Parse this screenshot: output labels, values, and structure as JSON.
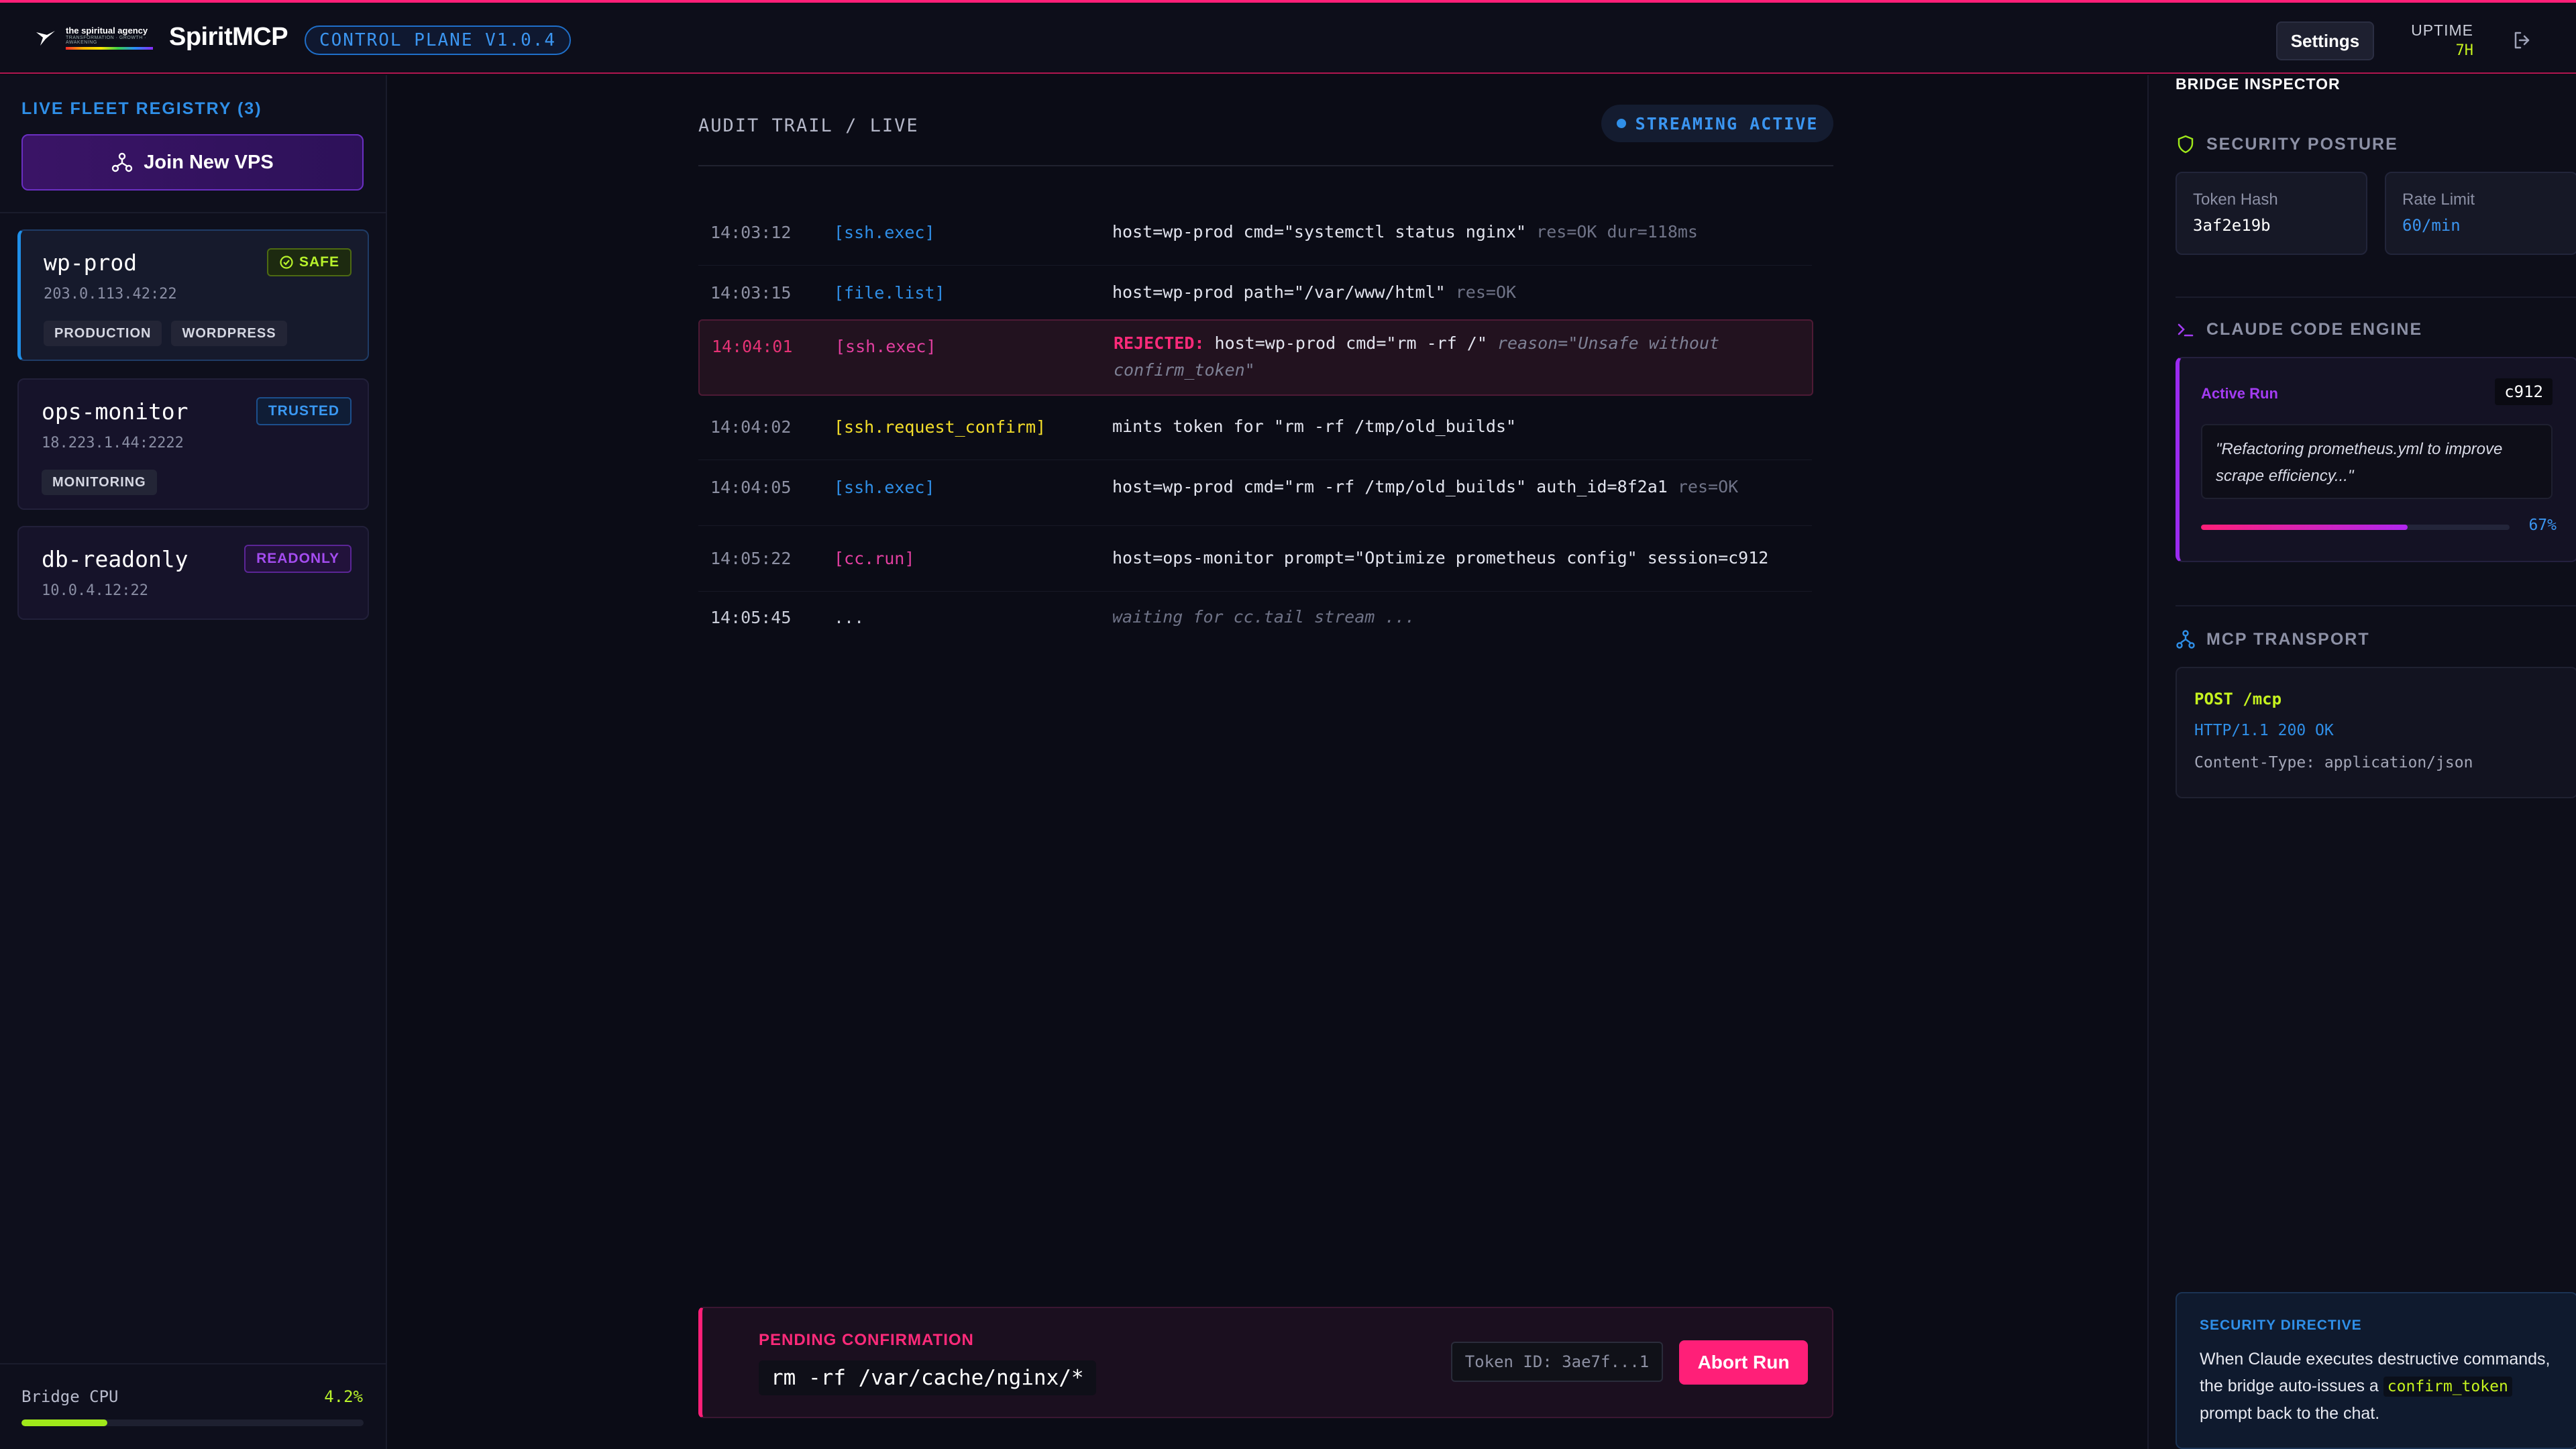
{
  "header": {
    "logo_line1": "the spiritual agency",
    "logo_line2": "TRANSFORMATION · GROWTH · AWAKENING",
    "brand": "SpiritMCP",
    "version": "CONTROL PLANE V1.0.4",
    "settings_label": "Settings",
    "uptime_label": "UPTIME",
    "uptime_value": "7H"
  },
  "sidebar": {
    "fleet_title": "LIVE FLEET REGISTRY (3)",
    "join_label": "Join New VPS",
    "hosts": [
      {
        "name": "wp-prod",
        "ip": "203.0.113.42:22",
        "badge": "SAFE",
        "tags": [
          "PRODUCTION",
          "WORDPRESS"
        ]
      },
      {
        "name": "ops-monitor",
        "ip": "18.223.1.44:2222",
        "badge": "TRUSTED",
        "tags": [
          "MONITORING"
        ]
      },
      {
        "name": "db-readonly",
        "ip": "10.0.4.12:22",
        "badge": "READONLY",
        "tags": []
      }
    ],
    "cpu_label": "Bridge CPU",
    "cpu_value": "4.2%",
    "cpu_fraction": 0.25
  },
  "audit": {
    "title": "AUDIT TRAIL / LIVE",
    "streaming_label": "STREAMING ACTIVE",
    "rows": [
      {
        "time": "14:03:12",
        "event": "[ssh.exec]",
        "msg": "host=wp-prod cmd=\"systemctl status nginx\"",
        "dim": " res=OK dur=118ms"
      },
      {
        "time": "14:03:15",
        "event": "[file.list]",
        "msg": "host=wp-prod path=\"/var/www/html\"",
        "dim": " res=OK"
      },
      {
        "time": "14:04:01",
        "event": "[ssh.exec]",
        "rejected": "REJECTED:",
        "msg": " host=wp-prod cmd=\"rm -rf /\"",
        "reason": " reason=\"Unsafe without confirm_token\""
      },
      {
        "time": "14:04:02",
        "event": "[ssh.request_confirm]",
        "msg": "mints token for \"rm -rf /tmp/old_builds\""
      },
      {
        "time": "14:04:05",
        "event": "[ssh.exec]",
        "msg": "host=wp-prod cmd=\"rm -rf /tmp/old_builds\" auth_id=8f2a1",
        "dim": " res=OK"
      },
      {
        "time": "14:05:22",
        "event": "[cc.run]",
        "msg": "host=ops-monitor prompt=\"Optimize prometheus config\" session=c912"
      },
      {
        "time": "14:05:45",
        "event": "...",
        "waiting": "waiting for cc.tail stream ..."
      }
    ]
  },
  "pending": {
    "label": "PENDING CONFIRMATION",
    "command": "rm -rf /var/cache/nginx/*",
    "token": "Token ID: 3ae7f...1",
    "abort_label": "Abort Run"
  },
  "inspector": {
    "title": "BRIDGE INSPECTOR",
    "security_title": "SECURITY POSTURE",
    "token_hash_label": "Token Hash",
    "token_hash_value": "3af2e19b",
    "rate_limit_label": "Rate Limit",
    "rate_limit_value": "60/min",
    "engine_title": "CLAUDE CODE ENGINE",
    "active_run_label": "Active Run",
    "run_id": "c912",
    "run_quote": "\"Refactoring prometheus.yml to improve scrape efficiency...\"",
    "run_progress": 0.67,
    "run_pct_label": "67%",
    "mcp_title": "MCP TRANSPORT",
    "mcp_line1": "POST /mcp",
    "mcp_line2": "HTTP/1.1 200 OK",
    "mcp_line3": "Content-Type: application/json",
    "directive_title": "SECURITY DIRECTIVE",
    "directive_pre": "When Claude executes destructive commands, the bridge auto-issues a ",
    "directive_code": "confirm_token",
    "directive_post": " prompt back to the chat."
  },
  "colors": {
    "accent_pink": "#ff1f78",
    "accent_blue": "#2f8fe8",
    "accent_lime": "#c6f31f",
    "accent_purple": "#9b2bf0"
  }
}
